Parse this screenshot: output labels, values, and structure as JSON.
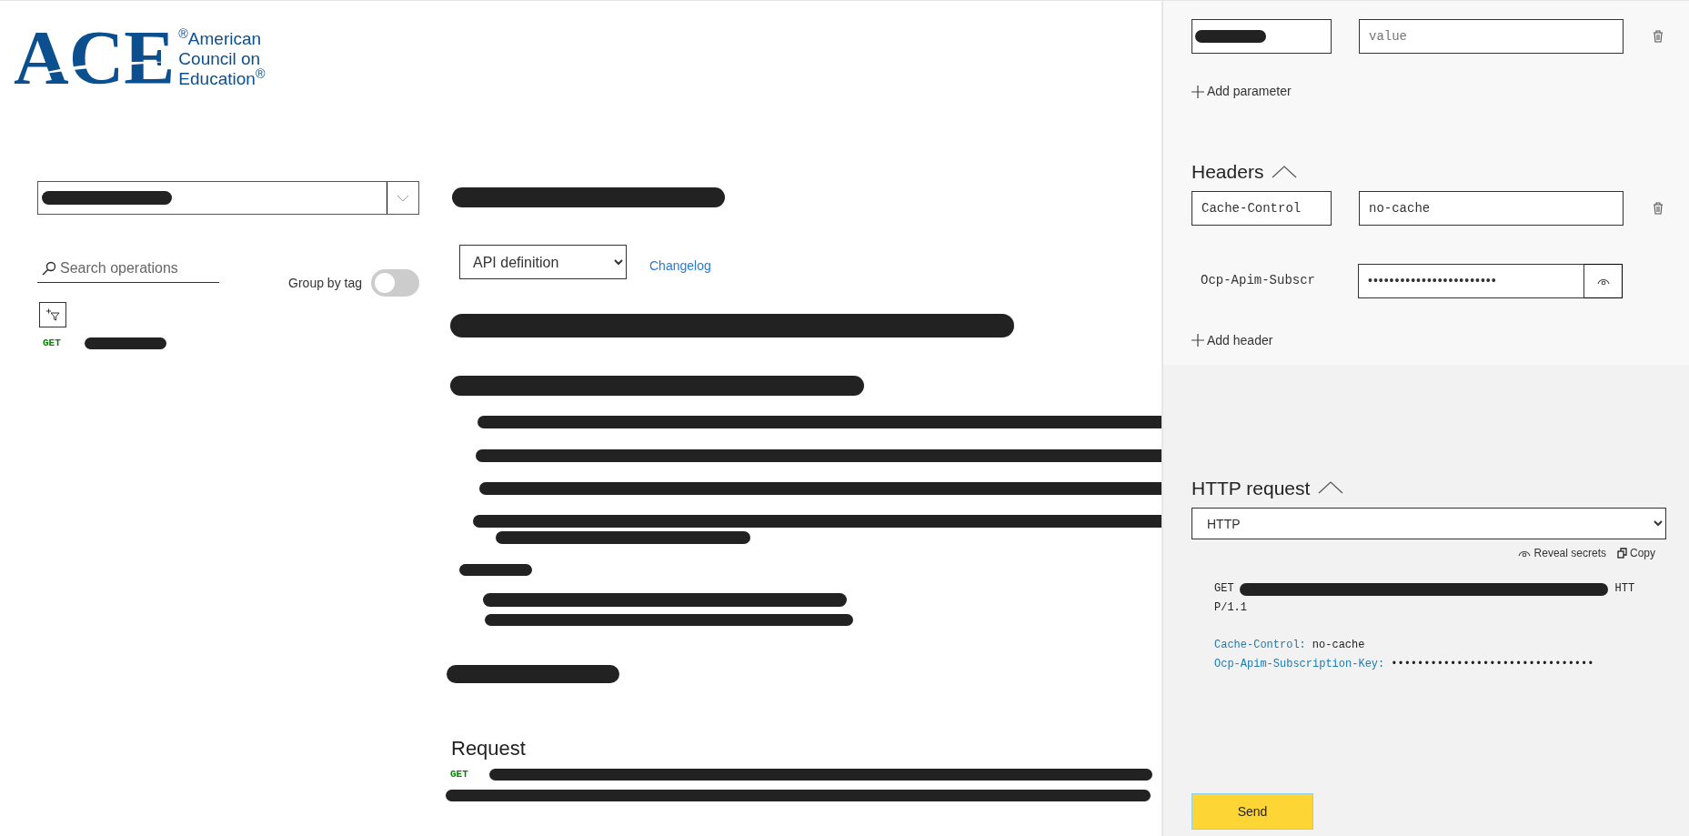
{
  "sidebar": {
    "logo": {
      "wordmark": "ACE",
      "lines": [
        "$^{®}$American",
        "Council on",
        "Education$^{®}$"
      ]
    },
    "search": {
      "placeholder": "Search operations"
    },
    "group_by_tag": {
      "label": "Group by tag",
      "on": false
    },
    "operations": [
      {
        "method": "GET",
        "selected": false
      }
    ]
  },
  "main": {
    "definition_select": {
      "value": "API definition"
    },
    "changelog": "Changelog",
    "request": {
      "heading": "Request",
      "method": "GET"
    }
  },
  "console": {
    "parameters": [
      {
        "value_placeholder": "value"
      }
    ],
    "add_parameter": "Add parameter",
    "headers": {
      "heading": "Headers",
      "expanded": true,
      "rows": [
        {
          "kind": "editable",
          "name": "Cache-Control",
          "value": "no-cache"
        },
        {
          "kind": "secret",
          "name": "Ocp-Apim-Subscr",
          "value": "••••••••••••••••••••••••"
        }
      ]
    },
    "add_header": "Add header",
    "http_request": {
      "heading": "HTTP request",
      "expanded": true,
      "format": "HTTP",
      "reveal": "Reveal secrets",
      "copy": "Copy",
      "request_line": {
        "method": "GET",
        "tail": "HTT",
        "wrap": "P/1.1"
      },
      "headers": [
        {
          "name": "Cache-Control:",
          "value": "no-cache"
        },
        {
          "name": "Ocp-Apim-Subscription-Key:",
          "value": "•••••••••••••••••••••••••••••••"
        }
      ]
    },
    "send": "Send"
  }
}
